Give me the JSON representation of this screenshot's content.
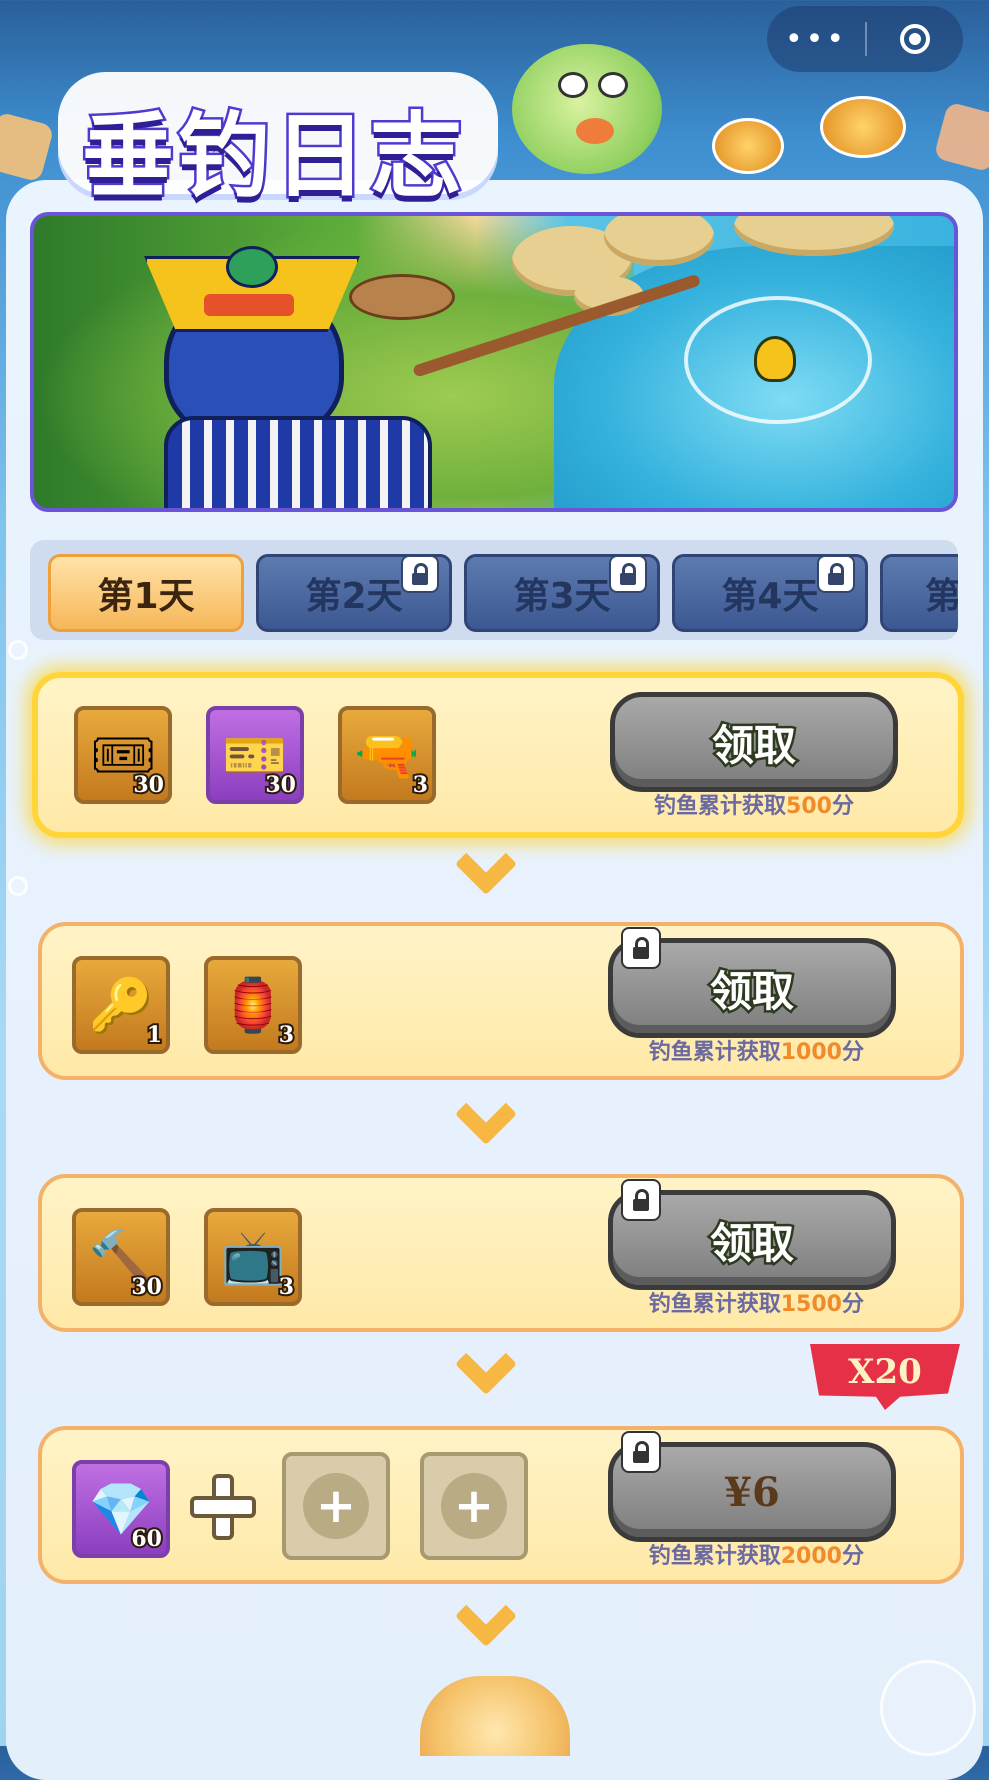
{
  "header": {
    "title": "垂钓日志",
    "menu_more": "•••",
    "close_target": "target-icon"
  },
  "tabs": [
    {
      "label": "第1天",
      "locked": false,
      "active": true
    },
    {
      "label": "第2天",
      "locked": true
    },
    {
      "label": "第3天",
      "locked": true
    },
    {
      "label": "第4天",
      "locked": true
    },
    {
      "label": "第",
      "locked": true
    }
  ],
  "rewards": [
    {
      "items": [
        {
          "icon": "red-ticket-icon",
          "qty": "30"
        },
        {
          "icon": "purple-ticket-icon",
          "qty": "30"
        },
        {
          "icon": "spray-gun-icon",
          "qty": "3"
        }
      ],
      "button_label": "领取",
      "locked": false,
      "req_prefix": "钓鱼累计获取",
      "req_value": "500",
      "req_suffix": "分"
    },
    {
      "items": [
        {
          "icon": "key-icon",
          "qty": "1"
        },
        {
          "icon": "lantern-icon",
          "qty": "3"
        }
      ],
      "button_label": "领取",
      "locked": true,
      "req_prefix": "钓鱼累计获取",
      "req_value": "1000",
      "req_suffix": "分"
    },
    {
      "items": [
        {
          "icon": "hammer-icon",
          "qty": "30"
        },
        {
          "icon": "robot-tv-icon",
          "qty": "3"
        }
      ],
      "button_label": "领取",
      "locked": true,
      "req_prefix": "钓鱼累计获取",
      "req_value": "1500",
      "req_suffix": "分"
    },
    {
      "items": [
        {
          "icon": "gem-icon",
          "qty": "60"
        }
      ],
      "button_label": "¥6",
      "locked": true,
      "badge": "X20",
      "req_prefix": "钓鱼累计获取",
      "req_value": "2000",
      "req_suffix": "分"
    }
  ],
  "colors": {
    "accent_orange": "#f08a2a",
    "tab_active": "#f6b759",
    "badge_red": "#e63048",
    "title_purple": "#4f3ad0"
  }
}
